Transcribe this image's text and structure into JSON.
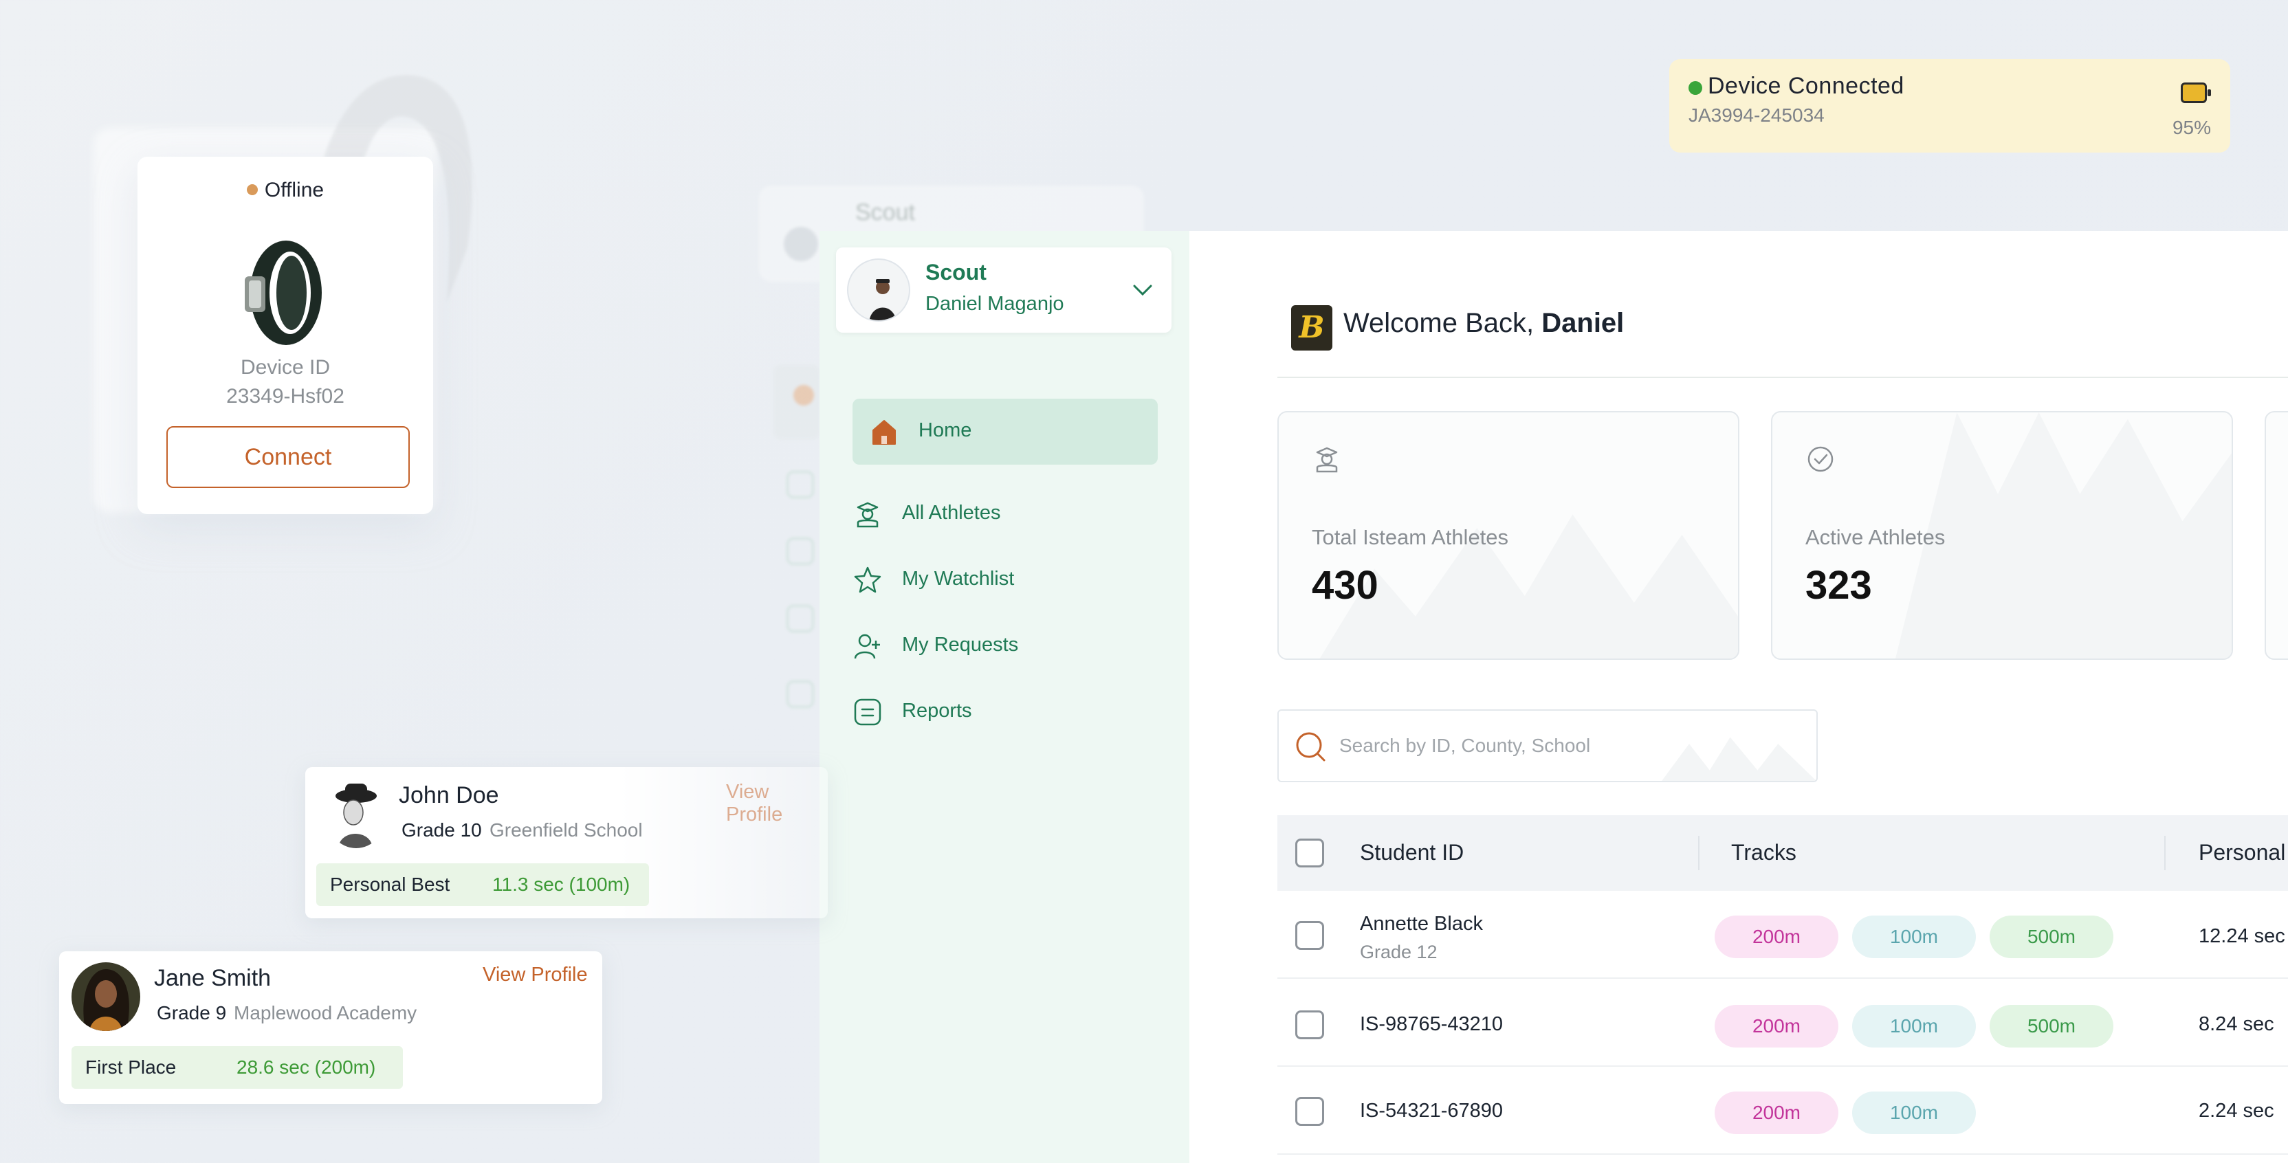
{
  "device_banner": {
    "title": "Device Connected",
    "device_id": "JA3994-245034",
    "battery": "95%"
  },
  "device_card": {
    "status": "Offline",
    "id_label": "Device ID",
    "id_value": "23349-Hsf02",
    "connect_label": "Connect"
  },
  "ghost": {
    "scout": "Scout"
  },
  "cards": [
    {
      "name": "John Doe",
      "grade": "Grade 10",
      "school": "Greenfield School",
      "view": "View Profile",
      "stat_label": "Personal Best",
      "stat_value": "11.3 sec (100m)"
    },
    {
      "name": "Jane Smith",
      "grade": "Grade 9",
      "school": "Maplewood Academy",
      "view": "View Profile",
      "stat_label": "First Place",
      "stat_value": "28.6 sec (200m)"
    }
  ],
  "sidebar": {
    "role": "Scout",
    "user": "Daniel Maganjo",
    "items": [
      {
        "label": "Home",
        "icon": "home-icon"
      },
      {
        "label": "All Athletes",
        "icon": "athlete-icon"
      },
      {
        "label": "My Watchlist",
        "icon": "star-icon"
      },
      {
        "label": "My Requests",
        "icon": "user-plus-icon"
      },
      {
        "label": "Reports",
        "icon": "report-icon"
      }
    ]
  },
  "main": {
    "welcome_prefix": "Welcome Back, ",
    "welcome_name": "Daniel",
    "logo_letter": "B",
    "stats": [
      {
        "label": "Total Isteam Athletes",
        "value": "430",
        "icon": "graduate-icon"
      },
      {
        "label": "Active  Athletes",
        "value": "323",
        "icon": "check-circle-icon"
      }
    ],
    "search_placeholder": "Search by ID, County, School",
    "table": {
      "headers": [
        "Student ID",
        "Tracks",
        "Personal"
      ],
      "rows": [
        {
          "id": "Annette Black",
          "sub": "Grade 12",
          "tracks": [
            "200m",
            "100m",
            "500m"
          ],
          "time": "12.24 sec"
        },
        {
          "id": "IS-98765-43210",
          "sub": "",
          "tracks": [
            "200m",
            "100m",
            "500m"
          ],
          "time": "8.24 sec"
        },
        {
          "id": "IS-54321-67890",
          "sub": "",
          "tracks": [
            "200m",
            "100m"
          ],
          "time": "2.24 sec"
        }
      ]
    }
  },
  "colors": {
    "accent": "#1f7a55",
    "orange": "#c4622a",
    "sidebar_bg": "#eef8f3",
    "banner_bg": "#fbf3d3"
  }
}
